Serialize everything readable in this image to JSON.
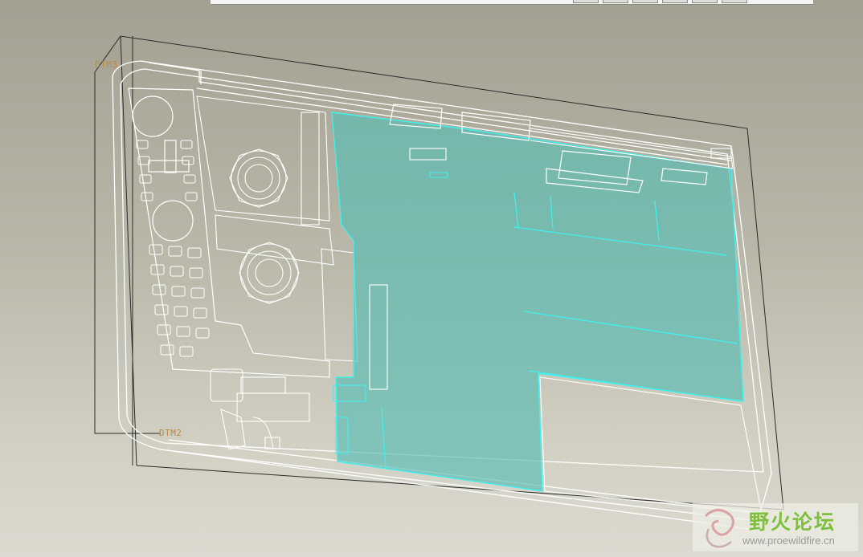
{
  "viewport": {
    "datums": {
      "top_left_label": "DTM3",
      "bottom_left_label": "DTM2"
    },
    "highlight_color": "#5bbcb4",
    "edge_color": "#ffffff"
  },
  "toolbar": {
    "button_count": 6
  },
  "watermark": {
    "title": "野火论坛",
    "url": "www.proewildfire.cn",
    "title_color": "#7fbf3e"
  }
}
